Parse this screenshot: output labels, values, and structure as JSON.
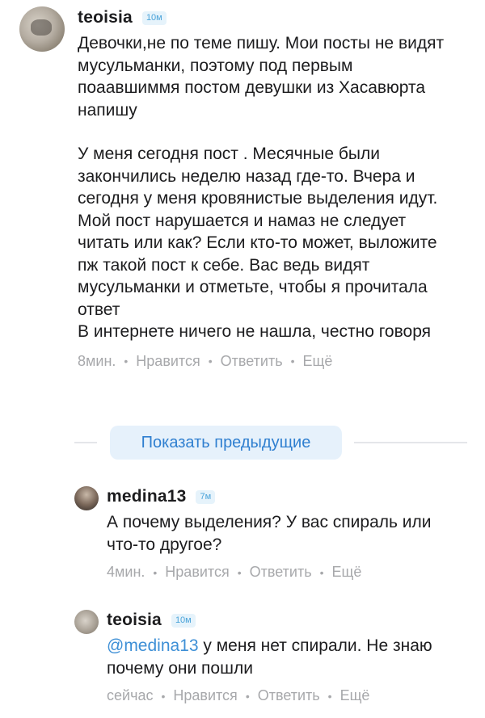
{
  "main_comment": {
    "username": "teoisia",
    "badge": "10м",
    "paragraph1": "Девочки,не по теме пишу. Мои посты не видят мусульманки, поэтому под первым поаавшиммя постом девушки из Хасавюрта напишу",
    "paragraph2": "У меня сегодня пост . Месячные были закончились неделю назад где-то. Вчера и сегодня у меня кровянистые выделения идут. Мой пост нарушается и намаз не следует читать или как? Если кто-то может, выложите пж такой пост к себе. Вас ведь видят мусульманки и отметьте, чтобы я прочитала ответ\nВ интернете ничего не нашла, честно говоря",
    "time": "8мин.",
    "like": "Нравится",
    "reply": "Ответить",
    "more": "Ещё"
  },
  "show_previous": "Показать предыдущие",
  "reply1": {
    "username": "medina13",
    "badge": "7м",
    "text": "А почему выделения? У вас спираль или что-то другое?",
    "time": "4мин.",
    "like": "Нравится",
    "reply": "Ответить",
    "more": "Ещё"
  },
  "reply2": {
    "username": "teoisia",
    "badge": "10м",
    "mention": "@medina13",
    "text": " у меня нет спирали. Не знаю почему они пошли",
    "time": "сейчас",
    "like": "Нравится",
    "reply": "Ответить",
    "more": "Ещё"
  },
  "separator": "•",
  "colors": {
    "accent": "#3d8fd6",
    "badge_bg": "#e6f3fb",
    "meta_gray": "#a7a8ab"
  }
}
